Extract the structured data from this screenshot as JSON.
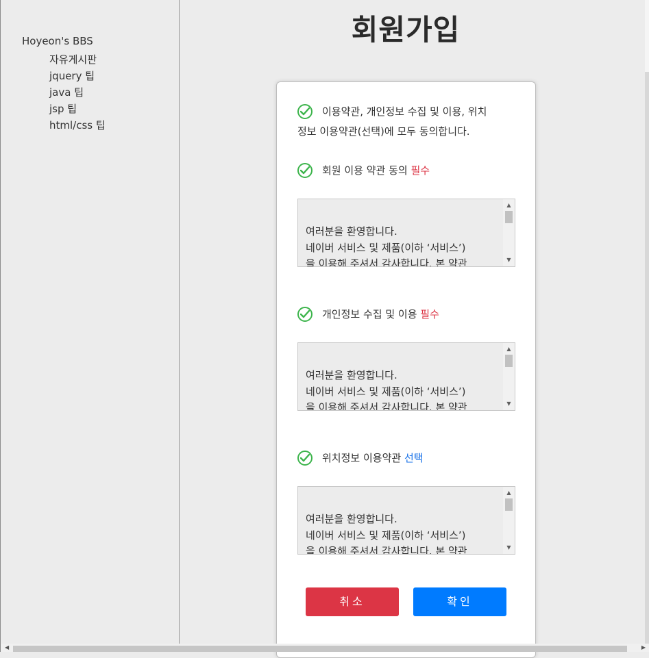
{
  "sidebar": {
    "site_title": "Hoyeon's BBS",
    "nav_items": [
      {
        "label": "자유게시판"
      },
      {
        "label": "jquery 팁"
      },
      {
        "label": "java 팁"
      },
      {
        "label": "jsp 팁"
      },
      {
        "label": "html/css 팁"
      }
    ]
  },
  "main": {
    "title": "회원가입",
    "agree_all": {
      "line1": "이용약관, 개인정보 수집 및 이용, 위치",
      "line2": "정보 이용약관(선택)에 모두 동의합니다."
    },
    "sections": [
      {
        "label": "회원 이용 약관 동의 ",
        "badge": "필수",
        "terms": "여러분을 환영합니다.\n네이버 서비스 및 제품(이하 ‘서비스’)\n을 이용해 주셔서 감사합니다. 본 약관"
      },
      {
        "label": "개인정보 수집 및 이용 ",
        "badge": "필수",
        "terms": "여러분을 환영합니다.\n네이버 서비스 및 제품(이하 ‘서비스’)\n을 이용해 주셔서 감사합니다. 본 약관"
      },
      {
        "label": "위치정보 이용약관 ",
        "badge": "선택",
        "terms": "여러분을 환영합니다.\n네이버 서비스 및 제품(이하 ‘서비스’)\n을 이용해 주셔서 감사합니다. 본 약관"
      }
    ],
    "buttons": {
      "cancel": "취소",
      "confirm": "확인"
    }
  },
  "colors": {
    "required": "#dc3545",
    "optional": "#1a73e8",
    "check": "#3cb44b",
    "cancel_bg": "#dc3545",
    "confirm_bg": "#007bff"
  },
  "icons": [
    "check-circle-icon",
    "scroll-up-icon",
    "scroll-down-icon"
  ]
}
